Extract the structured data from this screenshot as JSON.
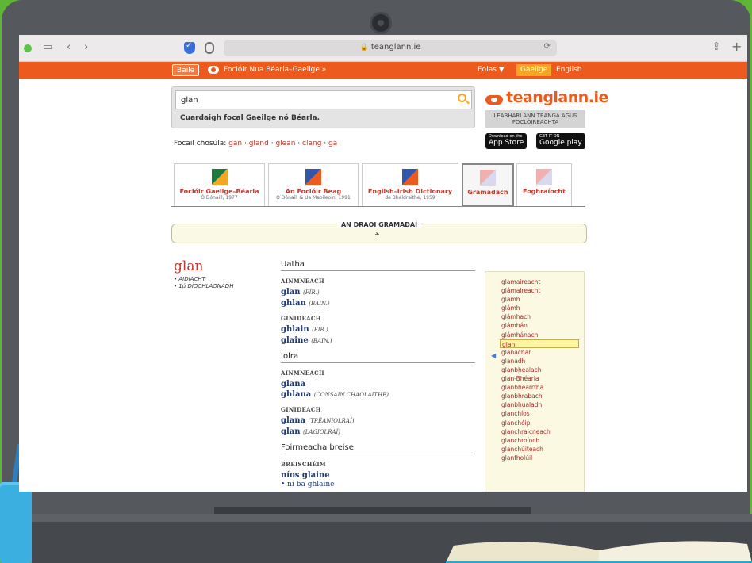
{
  "browser": {
    "url": "teanglann.ie"
  },
  "topnav": {
    "home": "Baile",
    "dict": "Foclóir Nua Béarla–Gaeilge »",
    "info": "Eolas ▼",
    "lang_active": "Gaeilge",
    "lang_other": "English"
  },
  "search": {
    "value": "glan",
    "hint": "Cuardaigh focal Gaeilge nó Béarla."
  },
  "logo": {
    "name": "teanglann.ie",
    "subtitle": "LEABHARLANN TEANGA AGUS FOCLÓIREACHTA",
    "app_store_small": "Download on the",
    "app_store": "App Store",
    "google_small": "GET IT ON",
    "google": "Google play"
  },
  "similar": {
    "label": "Focail chosúla:",
    "words": [
      "gan",
      "gland",
      "glean",
      "clang",
      "ga"
    ]
  },
  "tabs": [
    {
      "title": "Foclóir Gaeilge–Béarla",
      "sub": "Ó Dónaill, 1977",
      "flag": "#1e7a3c"
    },
    {
      "title": "An Foclóir Beag",
      "sub": "Ó Dónaill & Ua Maoileoin, 1991",
      "flag": "#ec5a1d"
    },
    {
      "title": "English–Irish Dictionary",
      "sub": "de Bhaldraithe, 1959",
      "flag": "#3355aa"
    },
    {
      "title": "Gramadach",
      "sub": "",
      "flag": "#e08a8a"
    },
    {
      "title": "Foghraíocht",
      "sub": "",
      "flag": "#e08a8a"
    }
  ],
  "draoi": {
    "title": "AN DRAOI GRAMADAÍ",
    "chevron": "≚"
  },
  "entry": {
    "headword": "glan",
    "pos1": "• AIDIACHT",
    "pos2": "• 1ú DÍOCHLAONADH"
  },
  "grammar": {
    "uatha": "Uatha",
    "ainm": "AINMNEACH",
    "glan": "glan",
    "fir": "(FIR.)",
    "ghlan": "ghlan",
    "bain": "(BAIN.)",
    "gin": "GINIDEACH",
    "ghlain": "ghlain",
    "glaine": "glaine",
    "iolra": "Iolra",
    "glana": "glana",
    "ghlana": "ghlana",
    "consain": "(CONSAIN CHAOLAITHE)",
    "treanl": "(TRÉANIOLRAÍ)",
    "lagiolrai": "(LAGIOLRAÍ)",
    "foirm": "Foirmeacha breise",
    "breis": "BREISCHÉIM",
    "nios": "níos glaine",
    "ni": "• ní ba ghlaine"
  },
  "wordlist": [
    "glamaireacht",
    "glámaireacht",
    "glamh",
    "glámh",
    "glámhach",
    "glámhán",
    "glámhánach",
    "glan",
    "glanachar",
    "glanadh",
    "glanbhealach",
    "glan-Bhéarla",
    "glanbhearrtha",
    "glanbhrabach",
    "glanbhualadh",
    "glanchíos",
    "glanchóip",
    "glanchraicneach",
    "glanchroíoch",
    "glanchúiteach",
    "glanfholúil"
  ]
}
